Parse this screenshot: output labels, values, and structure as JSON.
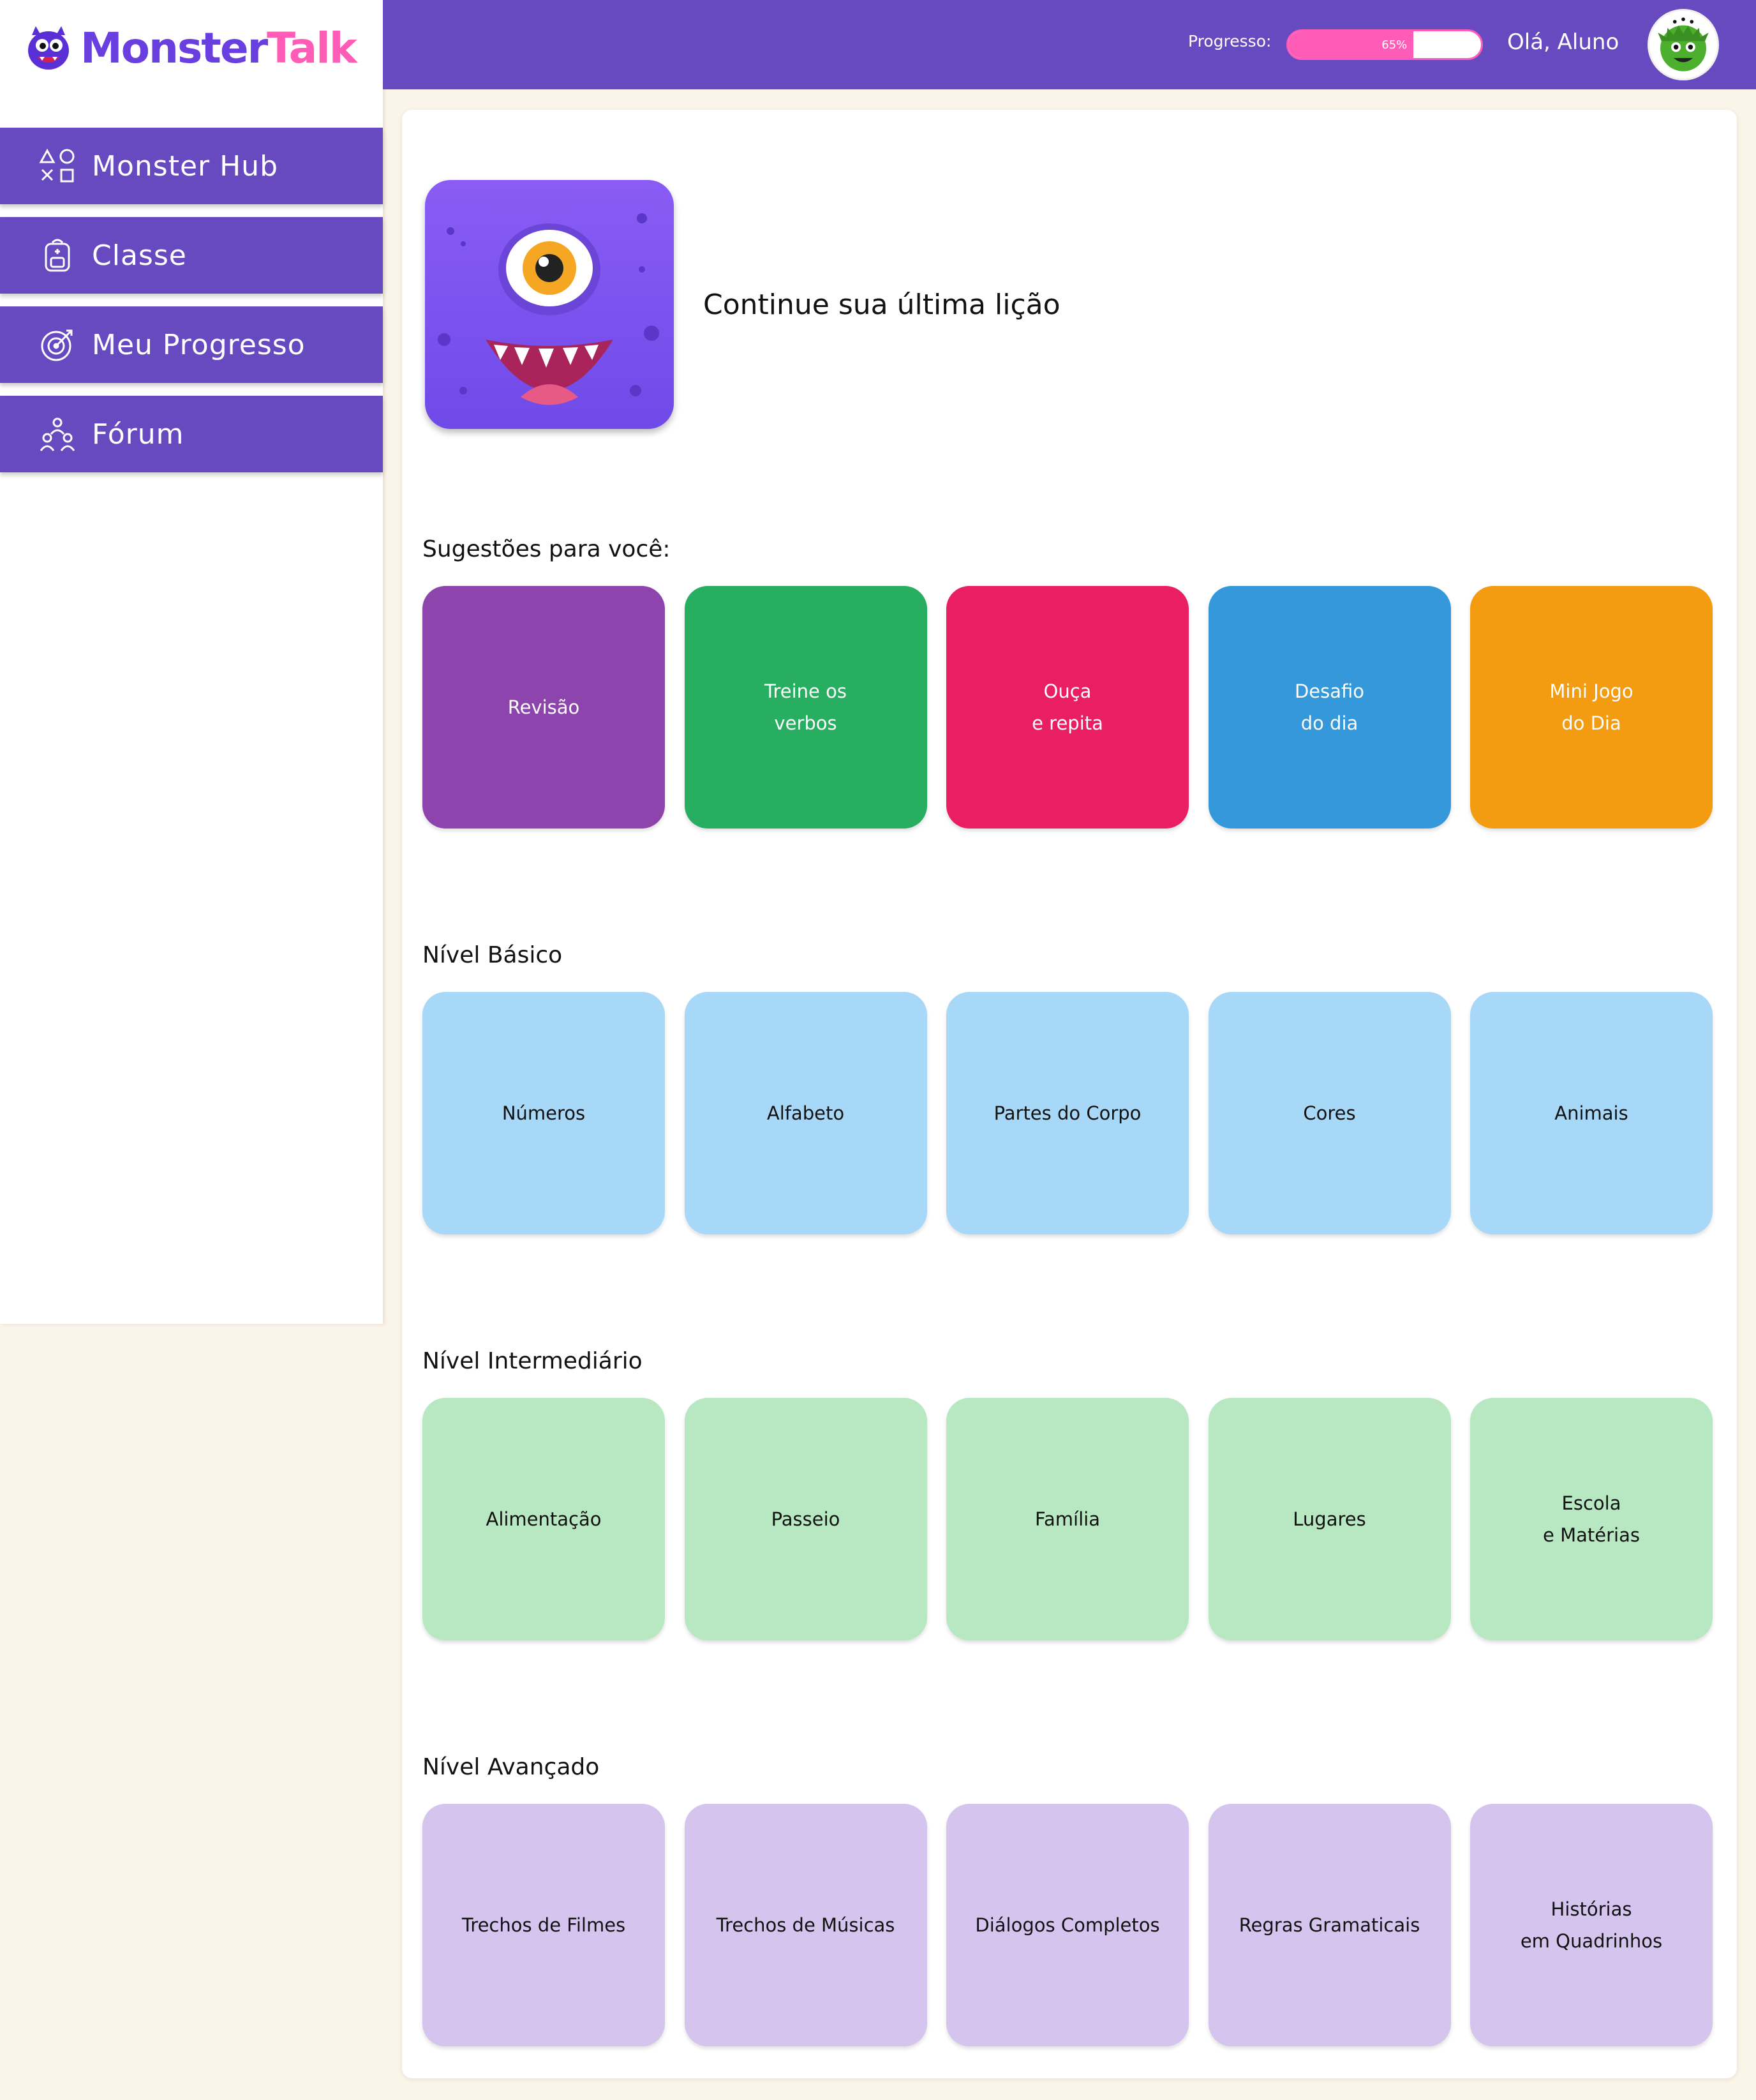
{
  "logo": {
    "part1": "Monster",
    "part2": "Talk"
  },
  "nav": [
    {
      "label": "Monster Hub",
      "icon": "shapes-icon"
    },
    {
      "label": "Classe",
      "icon": "backpack-icon"
    },
    {
      "label": "Meu Progresso",
      "icon": "target-icon"
    },
    {
      "label": "Fórum",
      "icon": "community-icon"
    }
  ],
  "header": {
    "progress_label": "Progresso:",
    "progress_value": 65,
    "progress_text": "65%",
    "greeting": "Olá, Aluno"
  },
  "last_lesson": {
    "title": "Continue sua última lição"
  },
  "sections": [
    {
      "title": "Sugestões para você:",
      "tiles": [
        {
          "label": "Revisão",
          "color": "#8e44ad"
        },
        {
          "label": "Treine os\nverbos",
          "color": "#27ae60"
        },
        {
          "label": "Ouça\ne repita",
          "color": "#e91e63"
        },
        {
          "label": "Desafio\ndo dia",
          "color": "#3498db"
        },
        {
          "label": "Mini Jogo\ndo Dia",
          "color": "#f39c12"
        }
      ]
    },
    {
      "title": "Nível Básico",
      "color": "#a8d8f8",
      "tiles": [
        {
          "label": "Números"
        },
        {
          "label": "Alfabeto"
        },
        {
          "label": "Partes do Corpo"
        },
        {
          "label": "Cores"
        },
        {
          "label": "Animais"
        }
      ]
    },
    {
      "title": "Nível Intermediário",
      "color": "#b8e8c2",
      "tiles": [
        {
          "label": "Alimentação"
        },
        {
          "label": "Passeio"
        },
        {
          "label": "Família"
        },
        {
          "label": "Lugares"
        },
        {
          "label": "Escola\ne Matérias"
        }
      ]
    },
    {
      "title": "Nível Avançado",
      "color": "#d4c4ee",
      "tiles": [
        {
          "label": "Trechos de Filmes"
        },
        {
          "label": "Trechos de Músicas"
        },
        {
          "label": "Diálogos Completos"
        },
        {
          "label": "Regras Gramaticais"
        },
        {
          "label": "Histórias\nem Quadrinhos"
        }
      ]
    }
  ],
  "colors": {
    "brand_purple": "#674ac0",
    "brand_pink": "#ff5cb8",
    "background": "#fbf4e9"
  }
}
